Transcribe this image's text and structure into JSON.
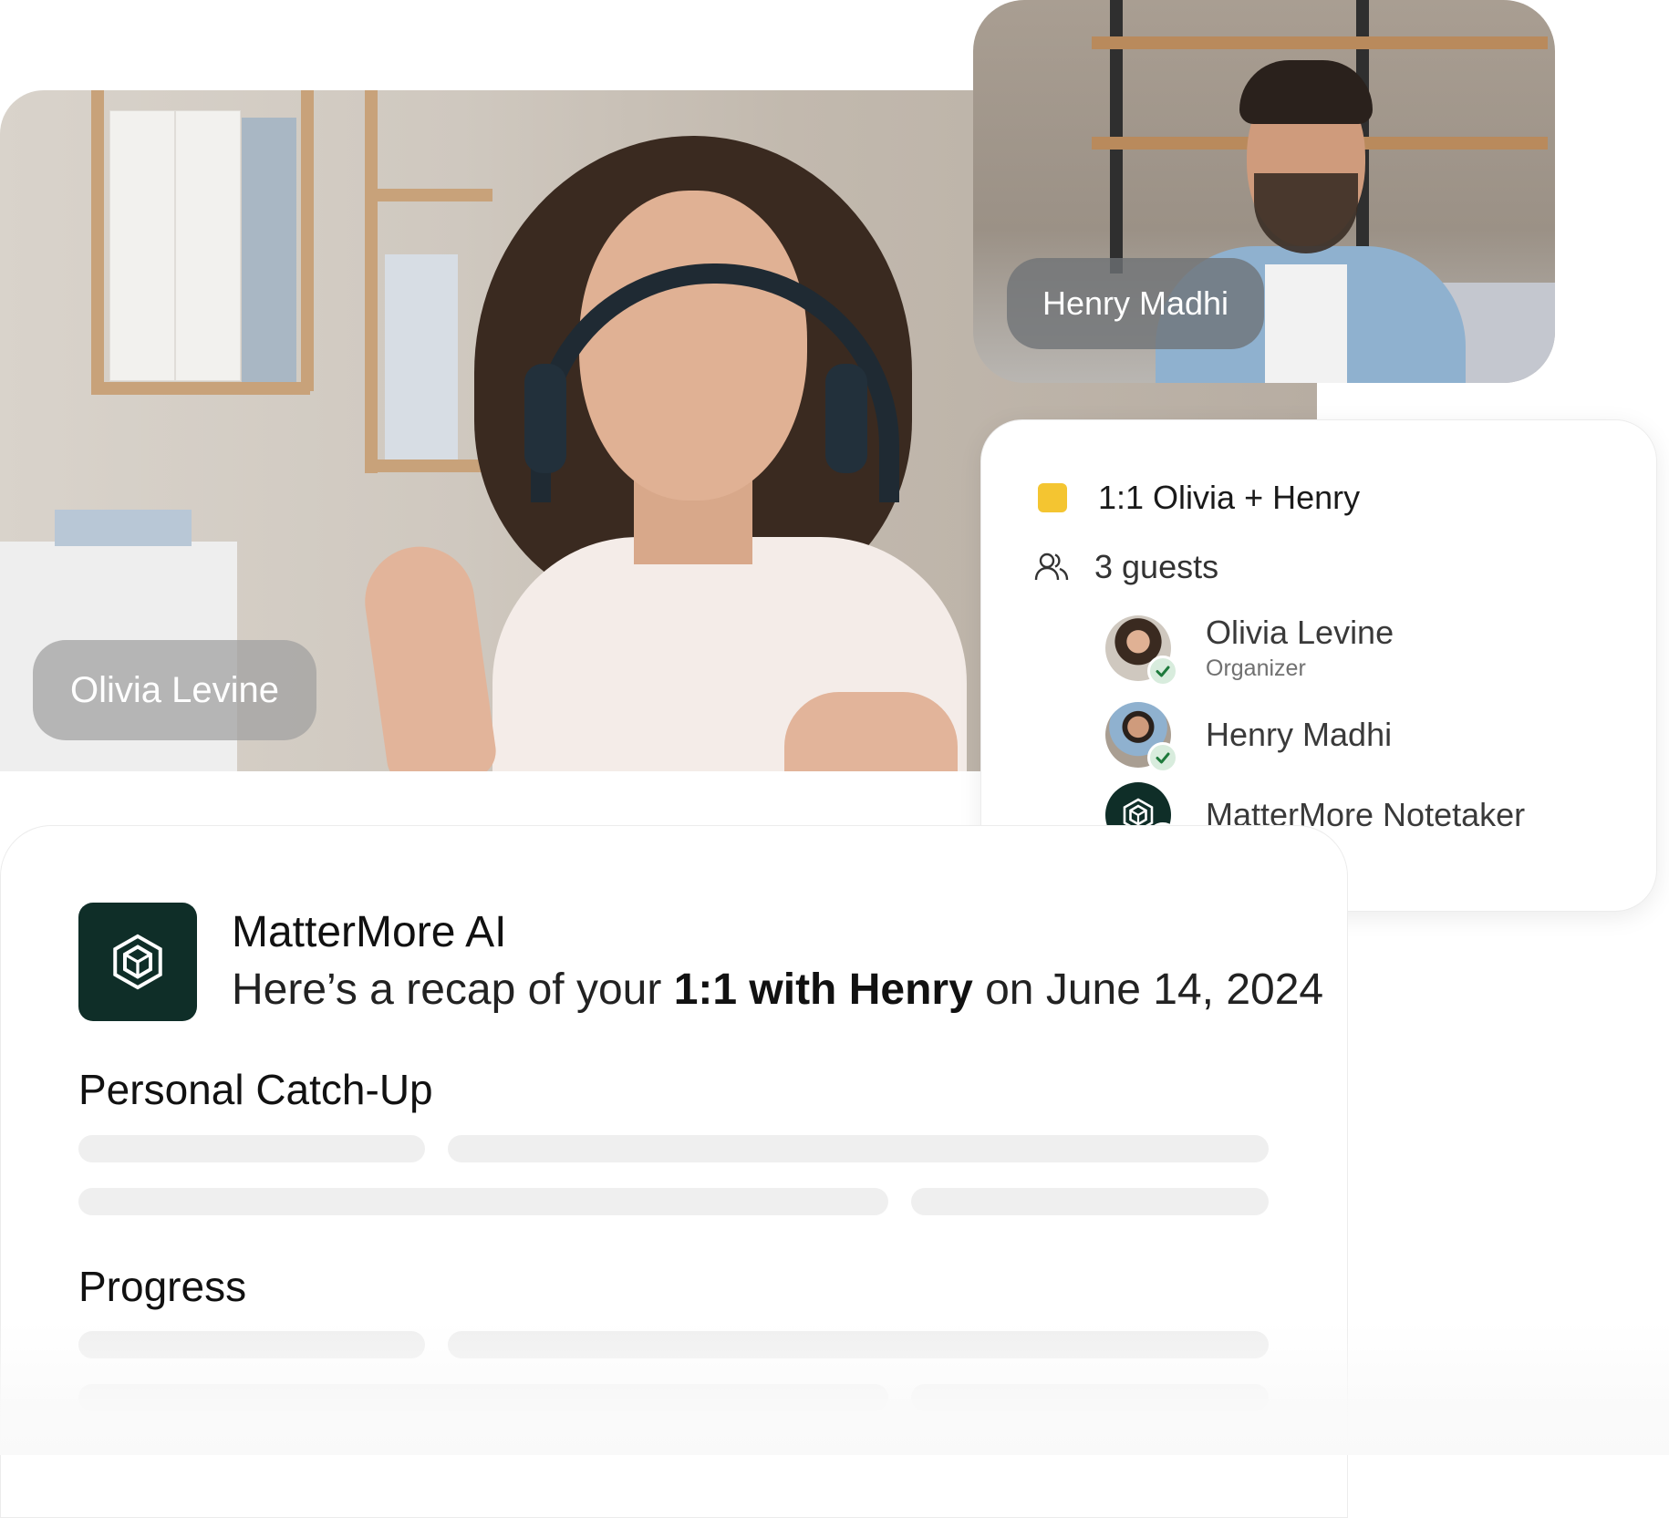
{
  "main_video": {
    "participant_name": "Olivia Levine"
  },
  "side_video": {
    "participant_name": "Henry Madhi"
  },
  "meeting": {
    "title": "1:1 Olivia + Henry",
    "calendar_color": "#f4c531",
    "guests_label": "3 guests",
    "attendees": [
      {
        "name": "Olivia Levine",
        "role": "Organizer",
        "avatar": "olivia-photo",
        "status": "accepted"
      },
      {
        "name": "Henry Madhi",
        "role": "",
        "avatar": "henry-photo",
        "status": "accepted"
      },
      {
        "name": "MatterMore Notetaker",
        "role": "",
        "avatar": "mattermore-logo",
        "status": "accepted"
      }
    ]
  },
  "recap": {
    "app_name": "MatterMore AI",
    "intro_prefix": "Here’s a recap of your ",
    "intro_highlight": "1:1 with Henry",
    "intro_suffix": " on June 14, 2024",
    "sections": [
      {
        "heading": "Personal Catch-Up"
      },
      {
        "heading": "Progress"
      }
    ]
  },
  "colors": {
    "brand_dark": "#0f2e28",
    "check_bg": "#d8ecdd",
    "check_mark": "#1e7a3c"
  }
}
